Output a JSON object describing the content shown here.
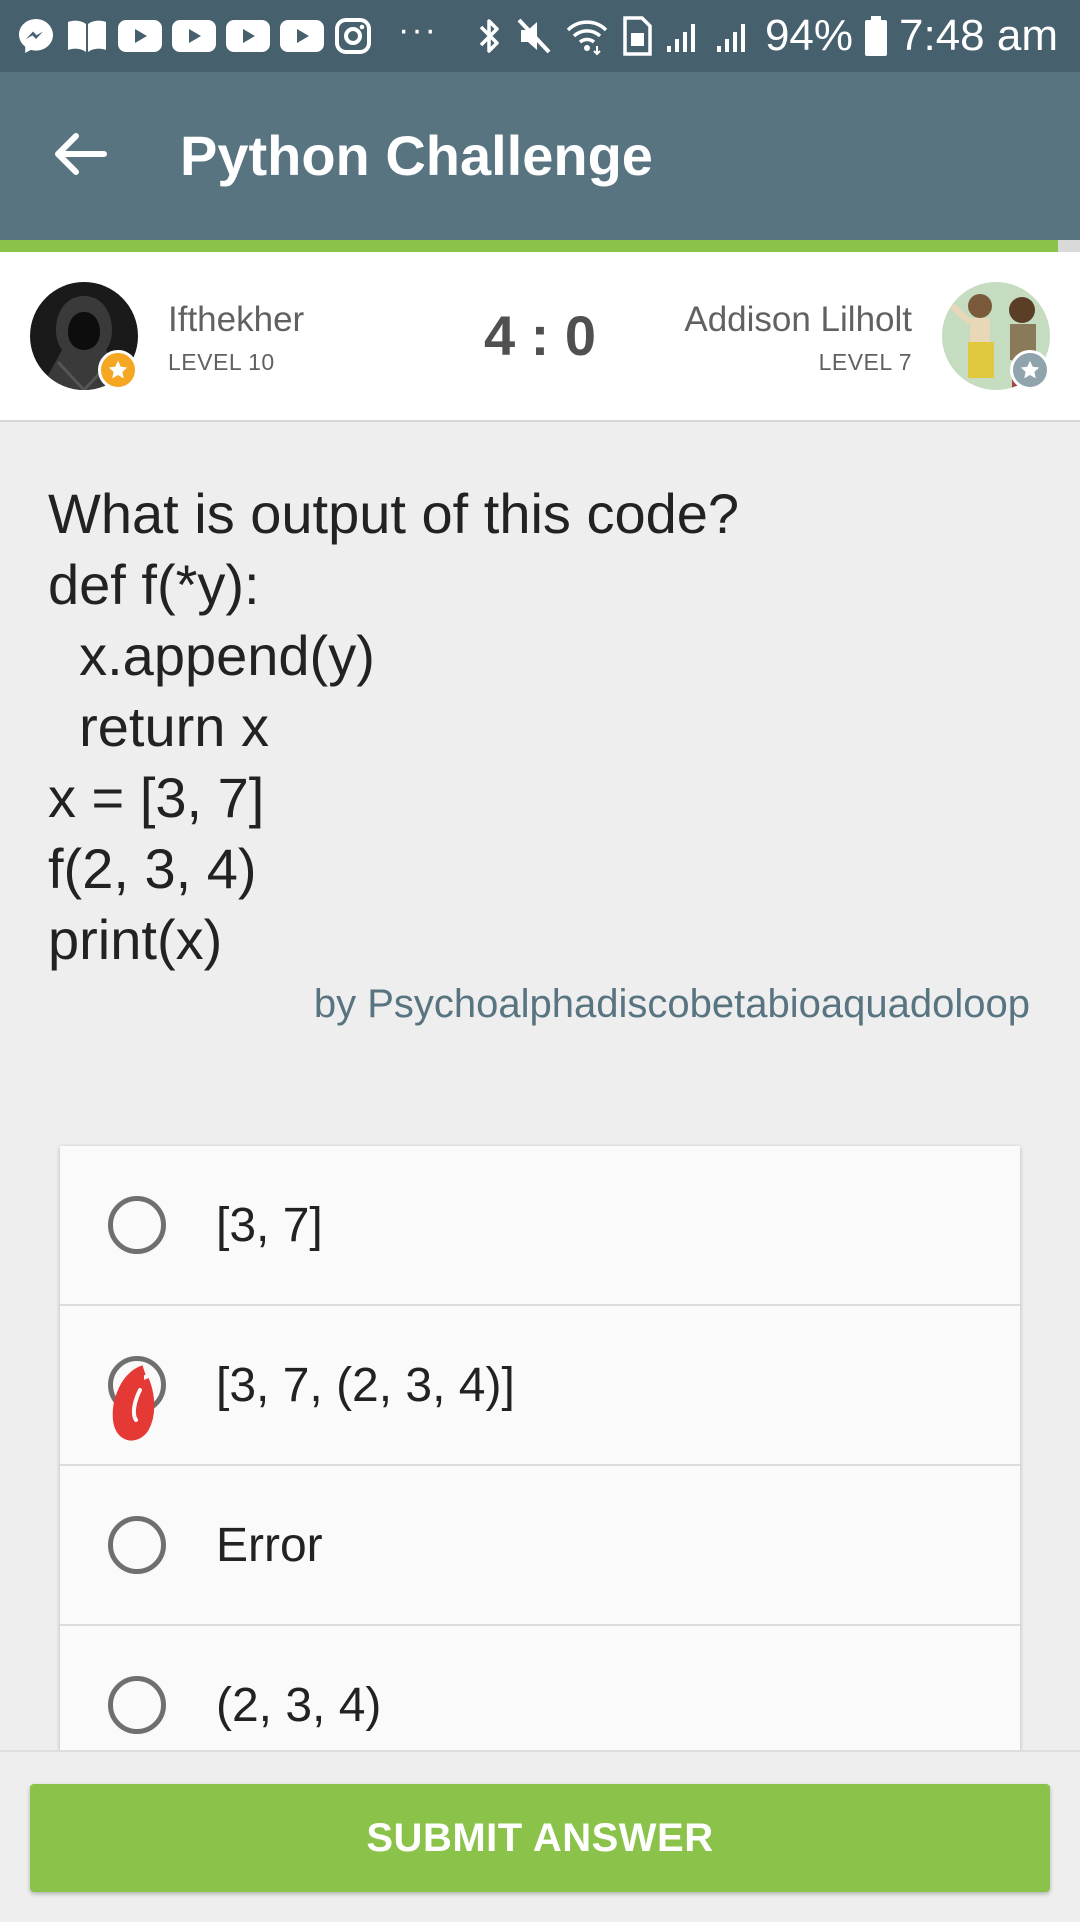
{
  "status_bar": {
    "notification_icons": [
      "messenger-icon",
      "book-icon",
      "youtube-icon",
      "youtube-icon",
      "youtube-icon",
      "youtube-icon",
      "instagram-icon"
    ],
    "more_indicator": "···",
    "system_icons": [
      "bluetooth-icon",
      "mute-icon",
      "wifi-icon",
      "sim-icon",
      "signal-icon",
      "signal-icon"
    ],
    "battery": "94%",
    "time": "7:48 am"
  },
  "app_bar": {
    "back_icon": "arrow-left-icon",
    "title": "Python Challenge"
  },
  "progress": {
    "fraction": 0.98
  },
  "match": {
    "player_left": {
      "name": "Ifthekher",
      "level": "LEVEL 10",
      "badge_icon": "star-icon",
      "badge_color": "#f5a623"
    },
    "score": "4 : 0",
    "player_right": {
      "name": "Addison Lilholt",
      "level": "LEVEL 7",
      "badge_icon": "star-icon",
      "badge_color": "#90a4ae"
    }
  },
  "question": {
    "text": "What is output of this code?\ndef f(*y):\n  x.append(y)\n  return x\nx = [3, 7]\nf(2, 3, 4)\nprint(x)",
    "author": "by Psychoalphadiscobetabioaquadoloop"
  },
  "options": [
    {
      "label": "[3, 7]",
      "selected": false
    },
    {
      "label": "[3, 7, (2, 3, 4)]",
      "selected": true
    },
    {
      "label": "Error",
      "selected": false
    },
    {
      "label": "(2, 3, 4)",
      "selected": false
    }
  ],
  "submit": {
    "label": "SUBMIT ANSWER"
  },
  "colors": {
    "status_bar": "#46606e",
    "app_bar": "#587480",
    "accent_green": "#8bc34a",
    "author_text": "#587480",
    "scribble_red": "#e53935"
  }
}
